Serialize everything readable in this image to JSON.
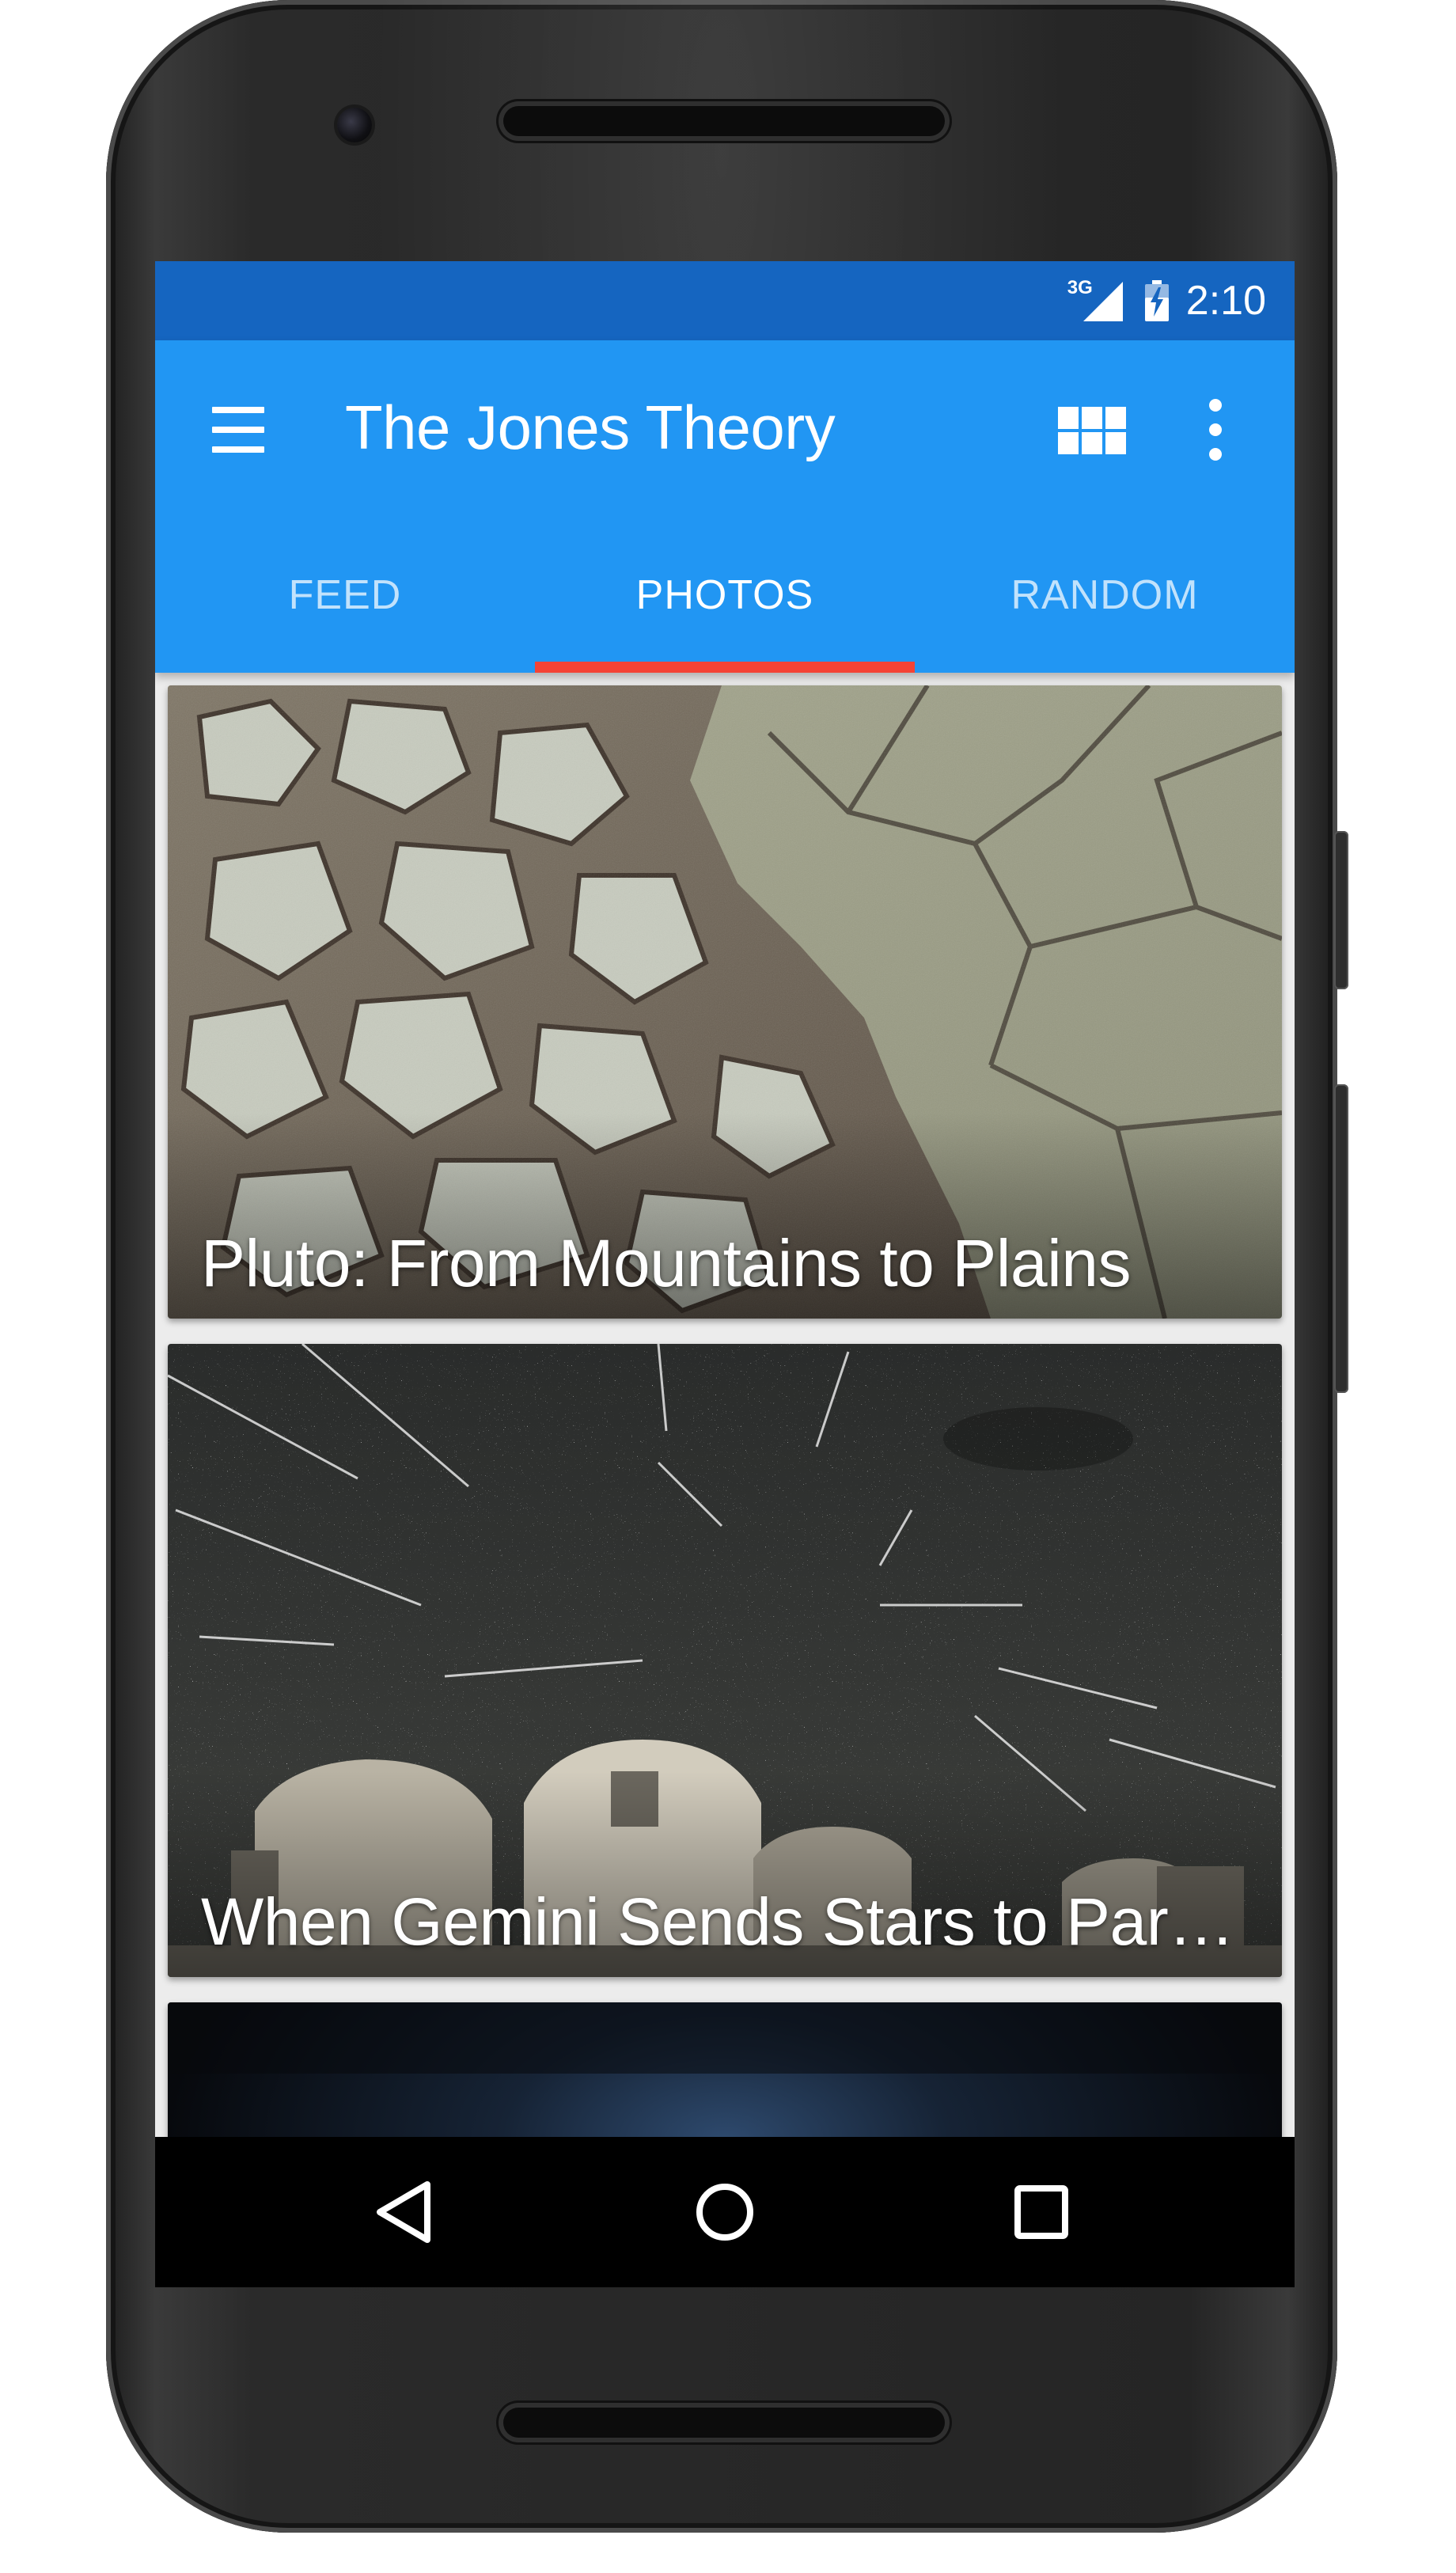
{
  "status_bar": {
    "network": "3G",
    "time": "2:10"
  },
  "app_bar": {
    "title": "The Jones Theory",
    "menu_icon": "hamburger-menu-icon",
    "grid_icon": "grid-view-icon",
    "overflow_icon": "more-vert-icon"
  },
  "tabs": [
    {
      "label": "FEED",
      "active": false
    },
    {
      "label": "PHOTOS",
      "active": true
    },
    {
      "label": "RANDOM",
      "active": false
    }
  ],
  "cards": [
    {
      "caption": "Pluto: From Mountains to Plains"
    },
    {
      "caption": "When Gemini Sends Stars to Par…"
    },
    {
      "caption": ""
    }
  ],
  "nav_bar": {
    "back_icon": "back-triangle-icon",
    "home_icon": "home-circle-icon",
    "recents_icon": "recents-square-icon"
  },
  "colors": {
    "primary": "#2196f3",
    "primary_dark": "#1565c0",
    "accent": "#f44336"
  }
}
